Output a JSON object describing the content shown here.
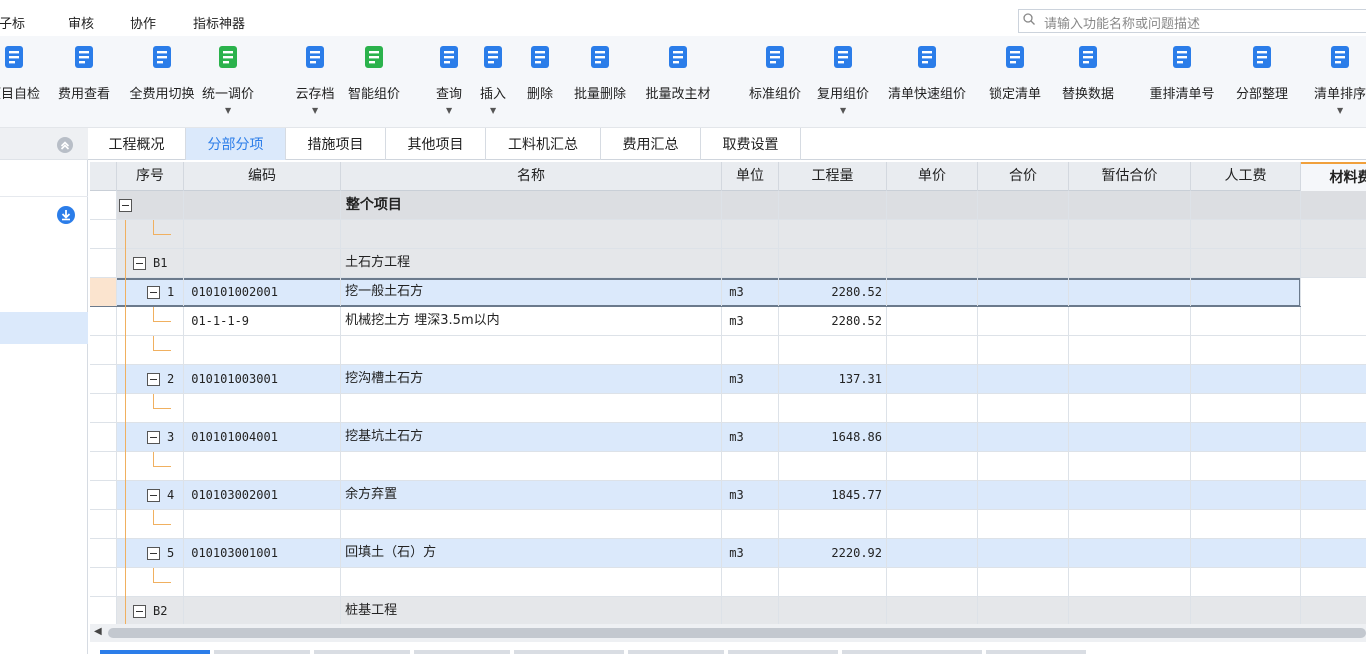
{
  "menu": [
    "电子标",
    "审核",
    "协作",
    "指标神器"
  ],
  "search": {
    "placeholder": "请输入功能名称或问题描述"
  },
  "toolbar": [
    {
      "label": "项目自检",
      "icon": "check-icon",
      "color": "#2b7de9",
      "arrow": false
    },
    {
      "label": "费用查看",
      "icon": "fee-view-icon",
      "color": "#2b7de9",
      "arrow": false
    },
    {
      "label": "全费用切换",
      "icon": "switch-icon",
      "color": "#2b7de9",
      "arrow": false
    },
    {
      "label": "统一调价",
      "icon": "price-adjust-icon",
      "color": "#2bb24c",
      "arrow": true
    },
    {
      "label": "云存档",
      "icon": "cloud-upload-icon",
      "color": "#2b7de9",
      "arrow": true
    },
    {
      "label": "智能组价",
      "icon": "smart-price-icon",
      "color": "#2bb24c",
      "arrow": false
    },
    {
      "label": "查询",
      "icon": "query-icon",
      "color": "#2b7de9",
      "arrow": true
    },
    {
      "label": "插入",
      "icon": "insert-icon",
      "color": "#2b7de9",
      "arrow": true
    },
    {
      "label": "删除",
      "icon": "delete-icon",
      "color": "#2b7de9",
      "arrow": false
    },
    {
      "label": "批量删除",
      "icon": "batch-delete-icon",
      "color": "#2b7de9",
      "arrow": false
    },
    {
      "label": "批量改主材",
      "icon": "batch-edit-icon",
      "color": "#2b7de9",
      "arrow": false
    },
    {
      "label": "标准组价",
      "icon": "standard-price-icon",
      "color": "#2b7de9",
      "arrow": false
    },
    {
      "label": "复用组价",
      "icon": "reuse-price-icon",
      "color": "#2b7de9",
      "arrow": true
    },
    {
      "label": "清单快速组价",
      "icon": "quick-price-icon",
      "color": "#2b7de9",
      "arrow": false
    },
    {
      "label": "锁定清单",
      "icon": "lock-icon",
      "color": "#2b7de9",
      "arrow": false
    },
    {
      "label": "替换数据",
      "icon": "replace-icon",
      "color": "#2b7de9",
      "arrow": false
    },
    {
      "label": "重排清单号",
      "icon": "reorder-icon",
      "color": "#2b7de9",
      "arrow": false
    },
    {
      "label": "分部整理",
      "icon": "organize-icon",
      "color": "#2b7de9",
      "arrow": false
    },
    {
      "label": "清单排序",
      "icon": "sort-icon",
      "color": "#2b7de9",
      "arrow": true
    }
  ],
  "tabs": [
    "工程概况",
    "分部分项",
    "措施项目",
    "其他项目",
    "工料机汇总",
    "费用汇总",
    "取费设置"
  ],
  "active_tab": "分部分项",
  "columns": [
    "序号",
    "编码",
    "名称",
    "单位",
    "工程量",
    "单价",
    "合价",
    "暂估合价",
    "人工费",
    "材料费"
  ],
  "rows": [
    {
      "seq": "",
      "code": "",
      "name": "整个项目",
      "unit": "",
      "qty": "",
      "type": "root"
    },
    {
      "seq": "",
      "code": "",
      "name": "",
      "unit": "",
      "qty": "",
      "type": "blank-gray"
    },
    {
      "seq": "B1",
      "code": "",
      "name": "土石方工程",
      "unit": "",
      "qty": "",
      "type": "section"
    },
    {
      "seq": "1",
      "code": "010101002001",
      "name": "挖一般土石方",
      "unit": "m3",
      "qty": "2280.52",
      "type": "item-selected"
    },
    {
      "seq": "",
      "code": "01-1-1-9",
      "name": "机械挖土方 埋深3.5m以内",
      "unit": "m3",
      "qty": "2280.52",
      "type": "sub"
    },
    {
      "seq": "",
      "code": "",
      "name": "",
      "unit": "",
      "qty": "",
      "type": "blank"
    },
    {
      "seq": "2",
      "code": "010101003001",
      "name": "挖沟槽土石方",
      "unit": "m3",
      "qty": "137.31",
      "type": "item"
    },
    {
      "seq": "",
      "code": "",
      "name": "",
      "unit": "",
      "qty": "",
      "type": "blank"
    },
    {
      "seq": "3",
      "code": "010101004001",
      "name": "挖基坑土石方",
      "unit": "m3",
      "qty": "1648.86",
      "type": "item"
    },
    {
      "seq": "",
      "code": "",
      "name": "",
      "unit": "",
      "qty": "",
      "type": "blank"
    },
    {
      "seq": "4",
      "code": "010103002001",
      "name": "余方弃置",
      "unit": "m3",
      "qty": "1845.77",
      "type": "item"
    },
    {
      "seq": "",
      "code": "",
      "name": "",
      "unit": "",
      "qty": "",
      "type": "blank"
    },
    {
      "seq": "5",
      "code": "010103001001",
      "name": "回填土（石）方",
      "unit": "m3",
      "qty": "2220.92",
      "type": "item"
    },
    {
      "seq": "",
      "code": "",
      "name": "",
      "unit": "",
      "qty": "",
      "type": "blank"
    },
    {
      "seq": "B2",
      "code": "",
      "name": "桩基工程",
      "unit": "",
      "qty": "",
      "type": "section"
    }
  ]
}
